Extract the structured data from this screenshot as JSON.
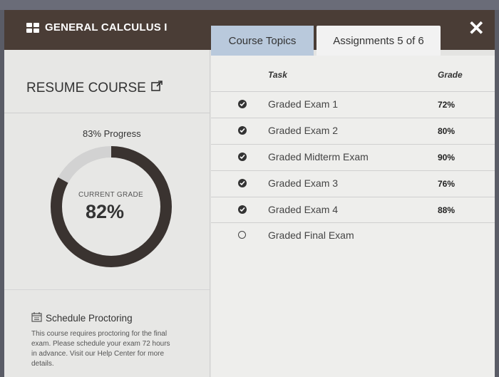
{
  "header": {
    "course_title": "GENERAL CALCULUS I",
    "close_label": "✕"
  },
  "tabs": [
    {
      "label": "Course Topics"
    },
    {
      "label": "Assignments 5 of 6"
    }
  ],
  "left": {
    "resume_label": "RESUME COURSE",
    "progress_label": "83% Progress",
    "progress_percent": 83,
    "current_grade_label": "CURRENT GRADE",
    "current_grade_value": "82%",
    "schedule": {
      "title": "Schedule Proctoring",
      "body": "This course requires proctoring for the final exam. Please schedule your exam 72 hours in advance. Visit our Help Center for more details."
    }
  },
  "table": {
    "headers": {
      "task": "Task",
      "grade": "Grade"
    },
    "rows": [
      {
        "task": "Graded Exam 1",
        "grade": "72%",
        "completed": true
      },
      {
        "task": "Graded Exam 2",
        "grade": "80%",
        "completed": true
      },
      {
        "task": "Graded Midterm Exam",
        "grade": "90%",
        "completed": true
      },
      {
        "task": "Graded Exam 3",
        "grade": "76%",
        "completed": true
      },
      {
        "task": "Graded Exam 4",
        "grade": "88%",
        "completed": true
      },
      {
        "task": "Graded Final Exam",
        "grade": "",
        "completed": false
      }
    ]
  },
  "colors": {
    "header_bg": "#4a3d36",
    "ring_filled": "#3a3330",
    "ring_empty": "#d2d2d2",
    "tab_active": "#b9c9dc"
  }
}
